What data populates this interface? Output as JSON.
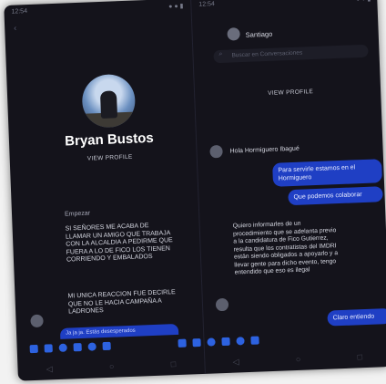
{
  "left": {
    "status_time": "12:54",
    "status_right": "● ● ▮",
    "profile_name": "Bryan Bustos",
    "view_profile": "VIEW PROFILE",
    "system_label": "Empezar",
    "message_1": "SI SEÑORES ME ACABA DE LLAMAR UN AMIGO QUE TRABAJA CON LA ALCALDIA A PEDIRME QUE FUERA A LO DE FICO LOS TIENEN CORRIENDO Y EMBALADOS",
    "message_2": "MI UNICA REACCION FUE DECIRLE QUE NO LE HACIA CAMPAÑA A LADRONES",
    "partial_reply": "Ja ja ja. Estás desesperados"
  },
  "right": {
    "status_time": "12:54",
    "status_right": "● ● ▮",
    "header_name": "Santiago",
    "search_placeholder": "Buscar en Conversaciones",
    "view_profile": "VIEW PROFILE",
    "incoming_1": "Hola Hormiguero Ibagué",
    "outgoing_1": "Para servirle estamos en el Hormiguero",
    "outgoing_2": "Que podemos colaborar",
    "incoming_2": "Quiero informarles de un procedimiento que se adelanta previo a la candidatura de Fico Gutierrez, resulta que los contratistas del IMDRI están siendo obligados a apoyarlo y a llevar gente para dicho evento, tengo entendido que eso es ilegal",
    "outgoing_3": "Claro entiendo"
  },
  "colors": {
    "background": "#14131b",
    "accent_blue": "#1f3fc4",
    "text_light": "#d4d6e0"
  }
}
